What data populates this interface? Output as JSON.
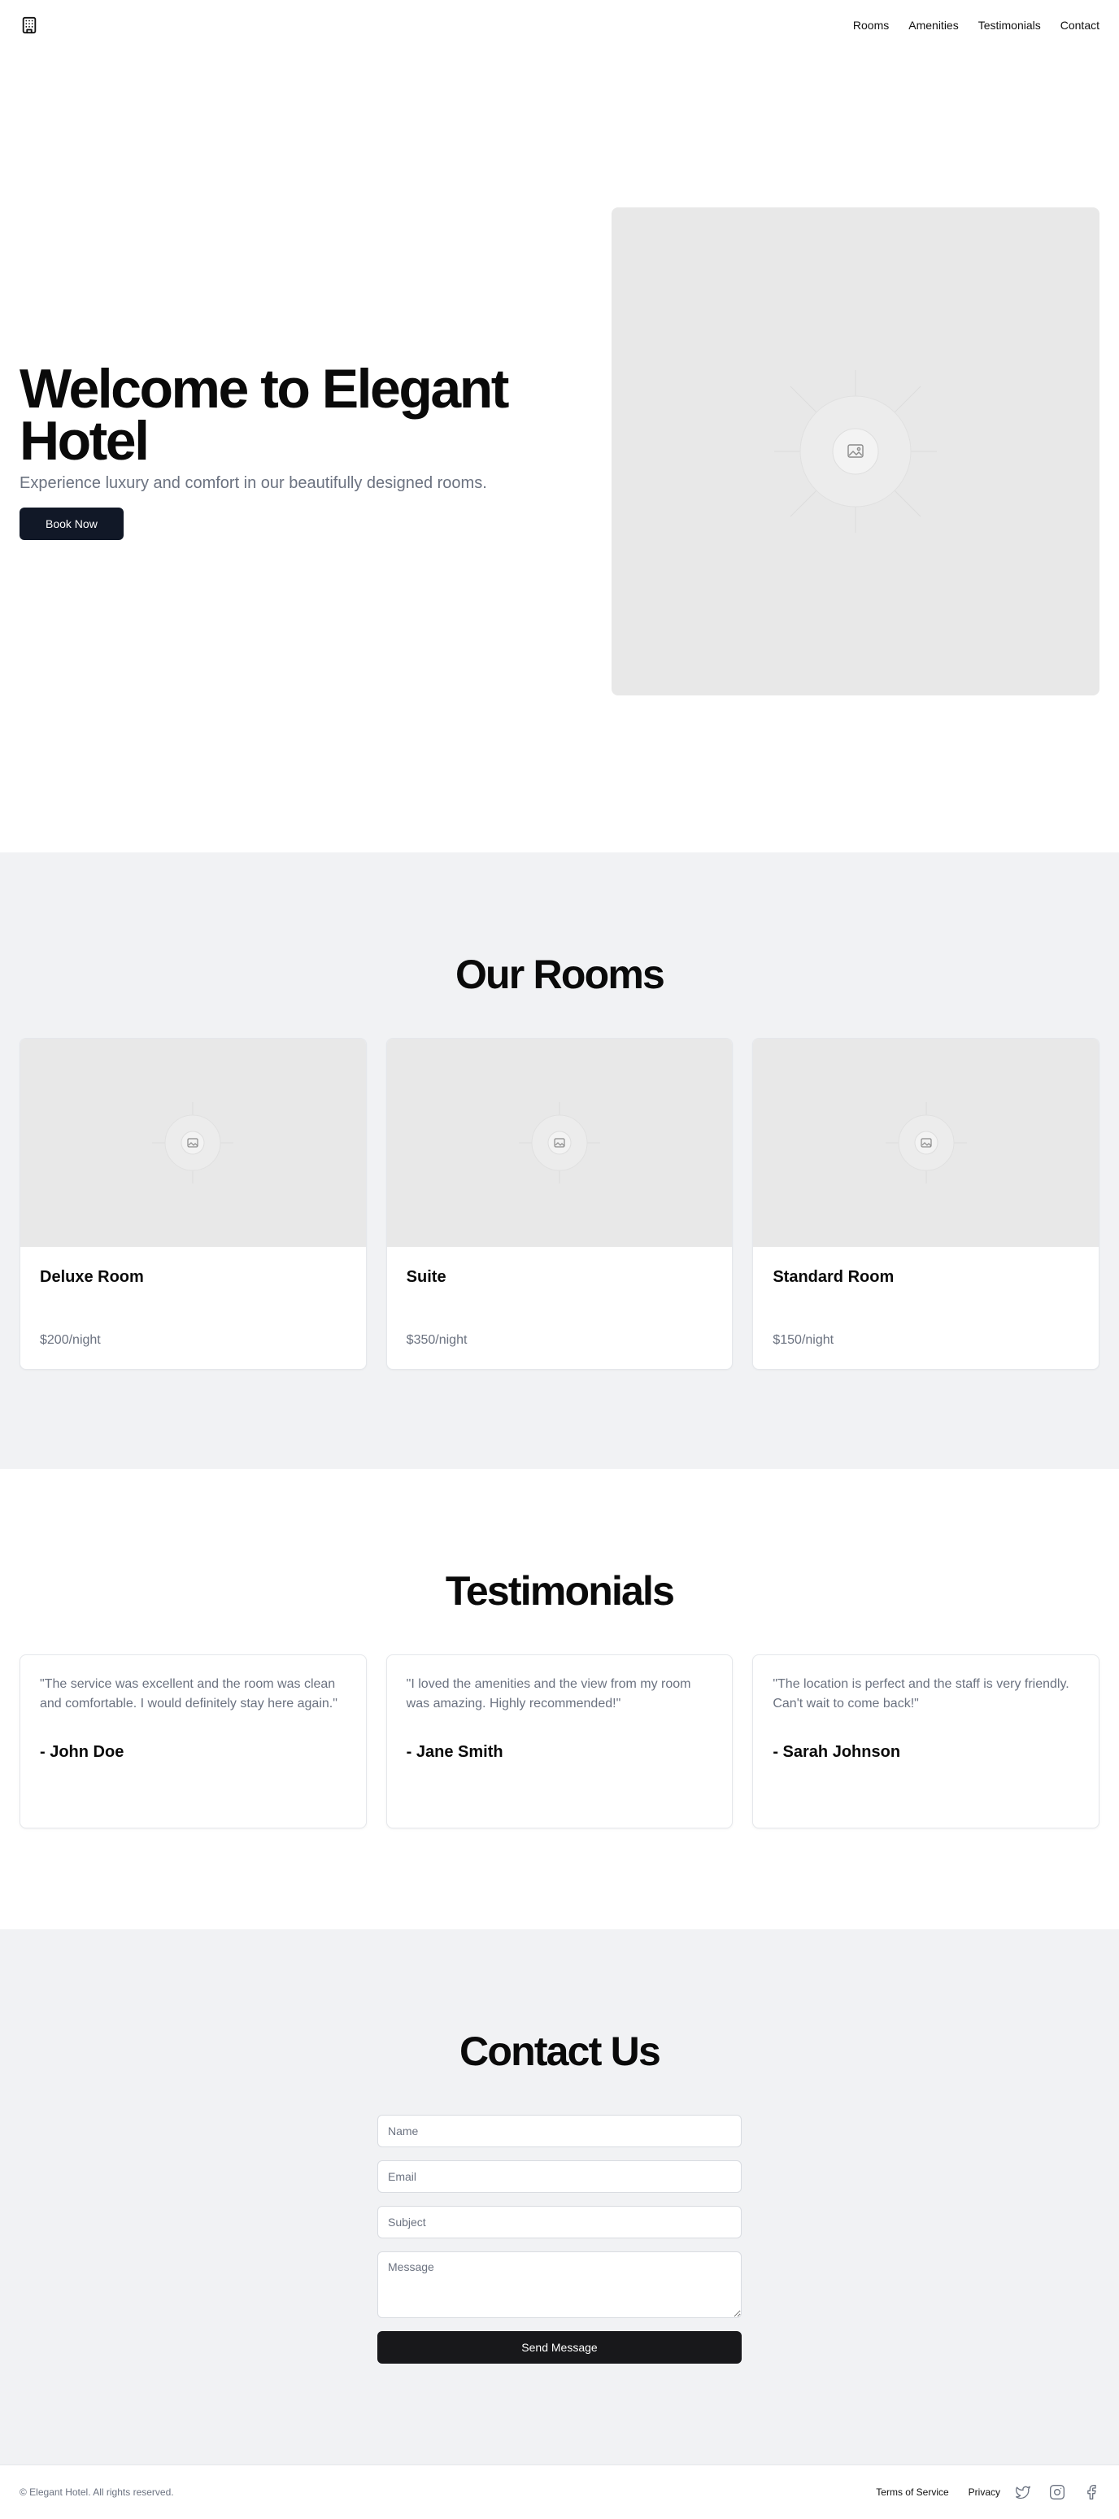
{
  "header": {
    "logo_icon": "building-icon",
    "nav": [
      {
        "label": "Rooms"
      },
      {
        "label": "Amenities"
      },
      {
        "label": "Testimonials"
      },
      {
        "label": "Contact"
      }
    ]
  },
  "hero": {
    "title": "Welcome to Elegant Hotel",
    "subtitle": "Experience luxury and comfort in our beautifully designed rooms.",
    "cta_label": "Book Now",
    "image_icon": "image-placeholder-icon"
  },
  "rooms": {
    "title": "Our Rooms",
    "items": [
      {
        "name": "Deluxe Room",
        "price": "$200/night"
      },
      {
        "name": "Suite",
        "price": "$350/night"
      },
      {
        "name": "Standard Room",
        "price": "$150/night"
      }
    ]
  },
  "testimonials": {
    "title": "Testimonials",
    "items": [
      {
        "quote": "\"The service was excellent and the room was clean and comfortable. I would definitely stay here again.\"",
        "author": "- John Doe"
      },
      {
        "quote": "\"I loved the amenities and the view from my room was amazing. Highly recommended!\"",
        "author": "- Jane Smith"
      },
      {
        "quote": "\"The location is perfect and the staff is very friendly. Can't wait to come back!\"",
        "author": "- Sarah Johnson"
      }
    ]
  },
  "contact": {
    "title": "Contact Us",
    "name_placeholder": "Name",
    "email_placeholder": "Email",
    "subject_placeholder": "Subject",
    "message_placeholder": "Message",
    "submit_label": "Send Message"
  },
  "footer": {
    "copyright": "© Elegant Hotel. All rights reserved.",
    "links": [
      {
        "label": "Terms of Service"
      },
      {
        "label": "Privacy"
      }
    ],
    "social_icons": [
      "twitter-icon",
      "instagram-icon",
      "facebook-icon"
    ]
  },
  "colors": {
    "primary_button": "#111827",
    "send_button": "#18181b",
    "muted_text": "#6b7280",
    "section_bg": "#f1f2f4",
    "placeholder_bg": "#e8e8e8"
  }
}
